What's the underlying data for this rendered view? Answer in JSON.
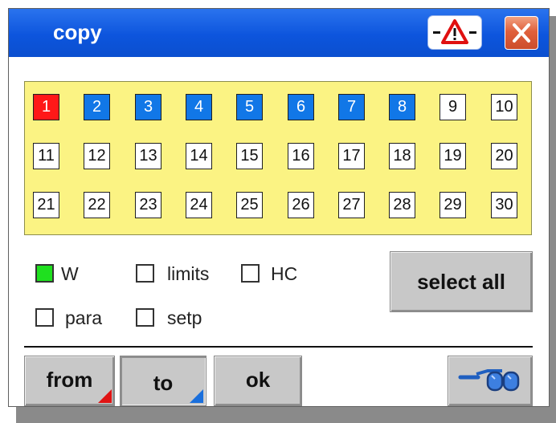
{
  "window": {
    "title": "copy"
  },
  "grid": {
    "cells": [
      {
        "label": "1",
        "state": "red"
      },
      {
        "label": "2",
        "state": "blue"
      },
      {
        "label": "3",
        "state": "blue"
      },
      {
        "label": "4",
        "state": "blue"
      },
      {
        "label": "5",
        "state": "blue"
      },
      {
        "label": "6",
        "state": "blue"
      },
      {
        "label": "7",
        "state": "blue"
      },
      {
        "label": "8",
        "state": "blue"
      },
      {
        "label": "9",
        "state": "white"
      },
      {
        "label": "10",
        "state": "white"
      },
      {
        "label": "11",
        "state": "white"
      },
      {
        "label": "12",
        "state": "white"
      },
      {
        "label": "13",
        "state": "white"
      },
      {
        "label": "14",
        "state": "white"
      },
      {
        "label": "15",
        "state": "white"
      },
      {
        "label": "16",
        "state": "white"
      },
      {
        "label": "17",
        "state": "white"
      },
      {
        "label": "18",
        "state": "white"
      },
      {
        "label": "19",
        "state": "white"
      },
      {
        "label": "20",
        "state": "white"
      },
      {
        "label": "21",
        "state": "white"
      },
      {
        "label": "22",
        "state": "white"
      },
      {
        "label": "23",
        "state": "white"
      },
      {
        "label": "24",
        "state": "white"
      },
      {
        "label": "25",
        "state": "white"
      },
      {
        "label": "26",
        "state": "white"
      },
      {
        "label": "27",
        "state": "white"
      },
      {
        "label": "28",
        "state": "white"
      },
      {
        "label": "29",
        "state": "white"
      },
      {
        "label": "30",
        "state": "white"
      }
    ]
  },
  "options": {
    "w": {
      "label": "W",
      "checked": true
    },
    "limits": {
      "label": "limits",
      "checked": false
    },
    "hc": {
      "label": "HC",
      "checked": false
    },
    "para": {
      "label": "para",
      "checked": false
    },
    "setp": {
      "label": "setp",
      "checked": false
    }
  },
  "buttons": {
    "select_all": "select all",
    "from": "from",
    "to": "to",
    "ok": "ok"
  },
  "icons": {
    "warning": "warning-triangle-icon",
    "close": "close-x-icon",
    "glasses": "glasses-icon"
  },
  "colors": {
    "titlebar": "#0d55dd",
    "grid_bg": "#fbf383",
    "cell_selected_red": "#ff1818",
    "cell_selected_blue": "#1177e7",
    "checkbox_on": "#1fe01f",
    "from_corner": "#e01414",
    "to_corner": "#1a6fdc"
  }
}
